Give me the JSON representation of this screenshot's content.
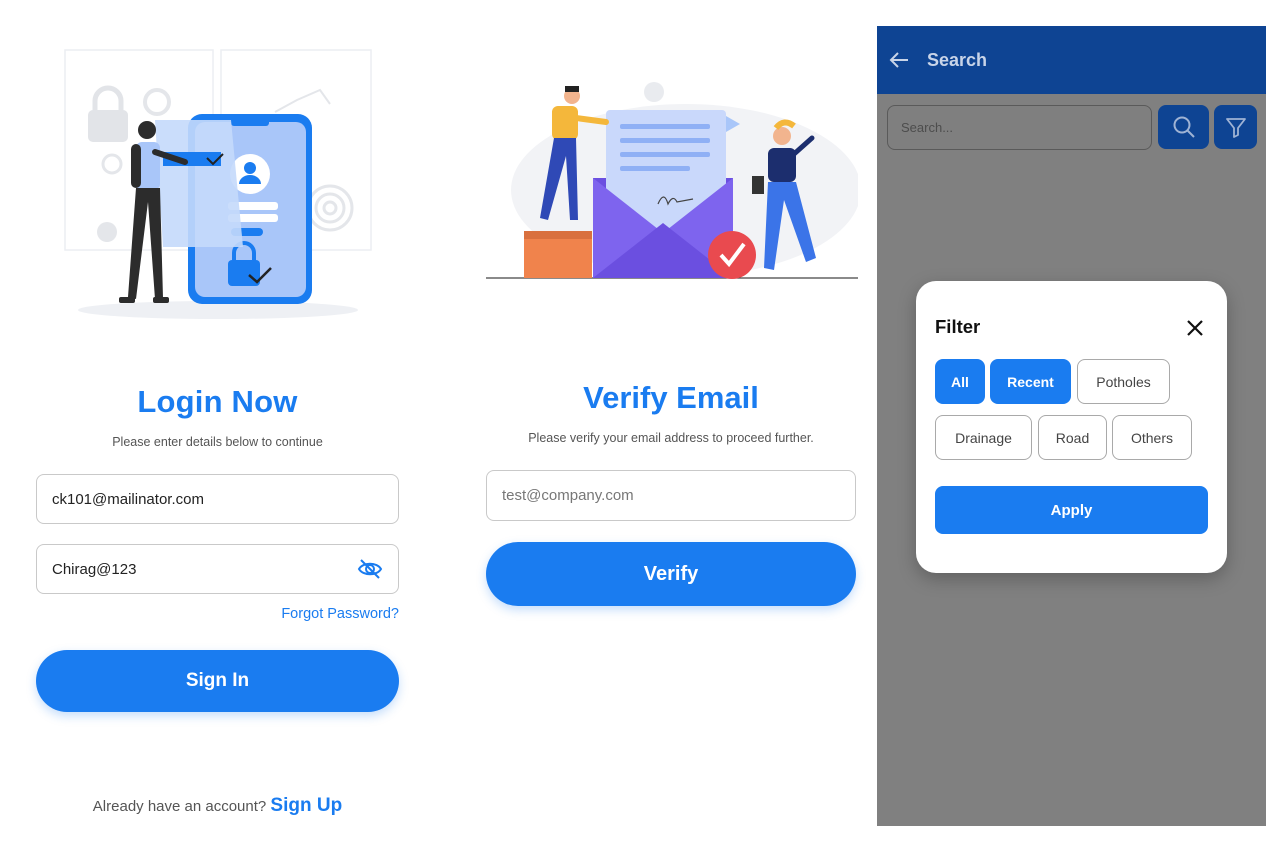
{
  "login": {
    "title": "Login Now",
    "subtitle": "Please enter details below to continue",
    "email_value": "ck101@mailinator.com",
    "password_value": "Chirag@123",
    "forgot_label": "Forgot Password?",
    "signin_label": "Sign In",
    "signup_prompt": "Already have an account?",
    "signup_link": "Sign Up"
  },
  "verify": {
    "title": "Verify Email",
    "subtitle": "Please verify your email address to proceed further.",
    "email_placeholder": "test@company.com",
    "verify_label": "Verify"
  },
  "search": {
    "appbar_title": "Search",
    "search_placeholder": "Search...",
    "filter": {
      "title": "Filter",
      "chips": [
        {
          "label": "All",
          "active": true
        },
        {
          "label": "Recent",
          "active": true
        },
        {
          "label": "Potholes",
          "active": false
        },
        {
          "label": "Drainage",
          "active": false
        },
        {
          "label": "Road",
          "active": false
        },
        {
          "label": "Others",
          "active": false
        }
      ],
      "apply_label": "Apply"
    }
  },
  "colors": {
    "accent": "#1a7cf0",
    "appbar": "#0e4493",
    "overlay": "#808080"
  },
  "icons": [
    "back-arrow-icon",
    "search-icon",
    "filter-icon",
    "close-icon",
    "eye-off-icon"
  ]
}
